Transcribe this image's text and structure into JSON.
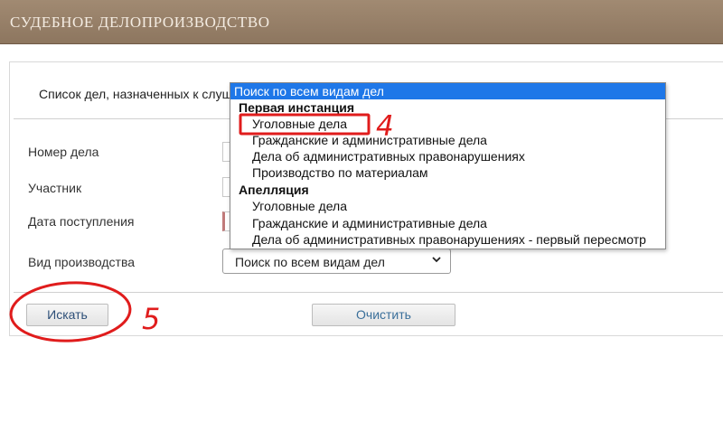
{
  "header": {
    "title": "СУДЕБНОЕ ДЕЛОПРОИЗВОДСТВО"
  },
  "colors": {
    "header_bg": "#8d765f",
    "selected_option_bg": "#1e77e8",
    "annotation_red": "#e01c1c"
  },
  "subtitle": "Список дел, назначенных к слушанию",
  "form": {
    "case_number_label": "Номер дела",
    "participant_label": "Участник",
    "receipt_date_label": "Дата поступления",
    "proceeding_type_label": "Вид производства",
    "proceeding_type_value": "Поиск по всем видам дел"
  },
  "buttons": {
    "search": "Искать",
    "clear": "Очистить"
  },
  "dropdown": {
    "selected": "Поиск по всем видам дел",
    "groups": [
      {
        "label": "Первая инстанция",
        "options": [
          "Уголовные дела",
          "Гражданские и административные дела",
          "Дела об административных правонарушениях",
          "Производство по материалам"
        ]
      },
      {
        "label": "Апелляция",
        "options": [
          "Уголовные дела",
          "Гражданские и административные дела",
          "Дела об административных правонарушениях - первый пересмотр"
        ]
      }
    ]
  },
  "annotations": {
    "step_4": "4",
    "step_5": "5"
  }
}
